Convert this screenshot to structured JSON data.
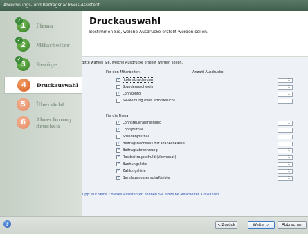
{
  "window": {
    "title": "Abrechnungs- und Beitragsnachweis-Assistent"
  },
  "steps": [
    {
      "number": "1",
      "label": "Firma",
      "state": "done"
    },
    {
      "number": "2",
      "label": "Mitarbeiter",
      "state": "done"
    },
    {
      "number": "3",
      "label": "Bezüge",
      "state": "done"
    },
    {
      "number": "4",
      "label": "Druckauswahl",
      "state": "active"
    },
    {
      "number": "5",
      "label": "Übersicht",
      "state": "pending"
    },
    {
      "number": "6",
      "label": "Abrechnung drucken",
      "state": "pending"
    }
  ],
  "header": {
    "title": "Druckauswahl",
    "subtitle": "Bestimmen Sie, welche Ausdrucke erstellt werden sollen."
  },
  "content": {
    "intro": "Bitte wählen Sie, welche Ausdrucke erstellt werden sollen.",
    "group_employees": "Für den Mitarbeiter:",
    "copies_header": "Anzahl Ausdrucke:",
    "employee_items": [
      {
        "label": "Lohnabrechnung",
        "checked": true,
        "copies": "1"
      },
      {
        "label": "Stundennachweis",
        "checked": false,
        "copies": "1"
      },
      {
        "label": "Lohnkonto",
        "checked": true,
        "copies": "1"
      },
      {
        "label": "SV-Meldung (falls erforderlich)",
        "checked": false,
        "copies": "1"
      }
    ],
    "group_company": "Für die Firma:",
    "company_items": [
      {
        "label": "Lohnsteueranmeldung",
        "checked": true,
        "copies": "1"
      },
      {
        "label": "Lohnjournal",
        "checked": true,
        "copies": "1"
      },
      {
        "label": "Stundenjournal",
        "checked": false,
        "copies": "1"
      },
      {
        "label": "Beitragsnachweis zur Krankenkasse",
        "checked": true,
        "copies": "1"
      },
      {
        "label": "Beitragsabrechnung",
        "checked": true,
        "copies": "1"
      },
      {
        "label": "Restbeitragsschuld (Vormonat)",
        "checked": true,
        "copies": "1"
      },
      {
        "label": "Buchungsliste",
        "checked": true,
        "copies": "1"
      },
      {
        "label": "Zahlungsliste",
        "checked": true,
        "copies": "1"
      },
      {
        "label": "Berufsgenossenschaftsliste",
        "checked": true,
        "copies": "1"
      }
    ],
    "hint": "Tipp: auf Seite 2 dieses Assistenten können Sie einzelne Mitarbeiter auswählen."
  },
  "footer": {
    "back_label": "< Zurück",
    "next_label": "Weiter >",
    "cancel_label": "Abbrechen",
    "help_icon": "help-icon"
  },
  "colors": {
    "title_bar": "#4c6d59",
    "step_done": "#3d8a3a",
    "step_active": "#e0662a",
    "step_pending": "#eb9a73",
    "hint_text": "#2f55b3"
  }
}
